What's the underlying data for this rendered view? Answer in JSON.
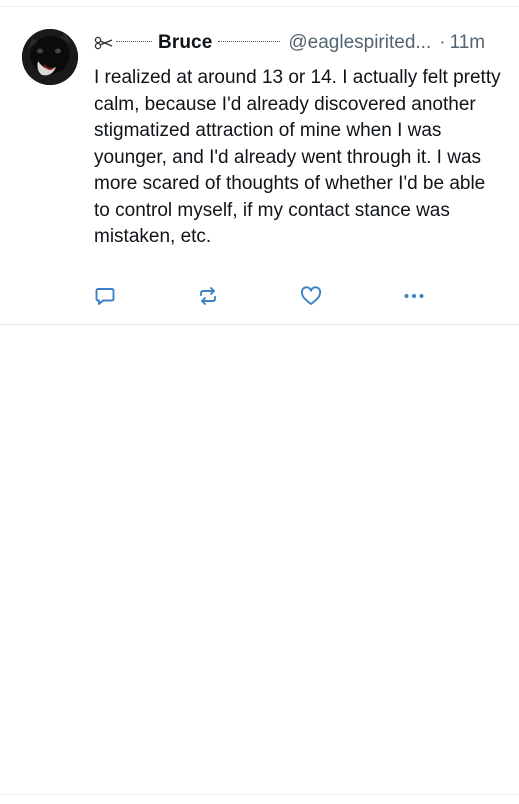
{
  "post": {
    "author_name": "Bruce",
    "handle": "@eaglespirited...",
    "separator": "·",
    "timestamp": "11m",
    "text": "I realized at around 13 or 14. I actually felt pretty calm, because I'd already discovered another stigmatized attraction of mine when I was younger, and I'd already went through it. I was more scared of thoughts of whether I'd be able to control myself, if my contact stance was mistaken, etc.",
    "avatar_icon": "black-dog-avatar",
    "name_decoration_icon": "scissors-icon"
  },
  "actions": [
    {
      "icon": "reply-icon"
    },
    {
      "icon": "repost-icon"
    },
    {
      "icon": "like-heart-icon"
    },
    {
      "icon": "more-options-icon"
    }
  ],
  "colors": {
    "text": "#0f1419",
    "secondary_text": "#536471",
    "icon_blue": "#3b82c4",
    "divider": "#e6e8eb"
  }
}
